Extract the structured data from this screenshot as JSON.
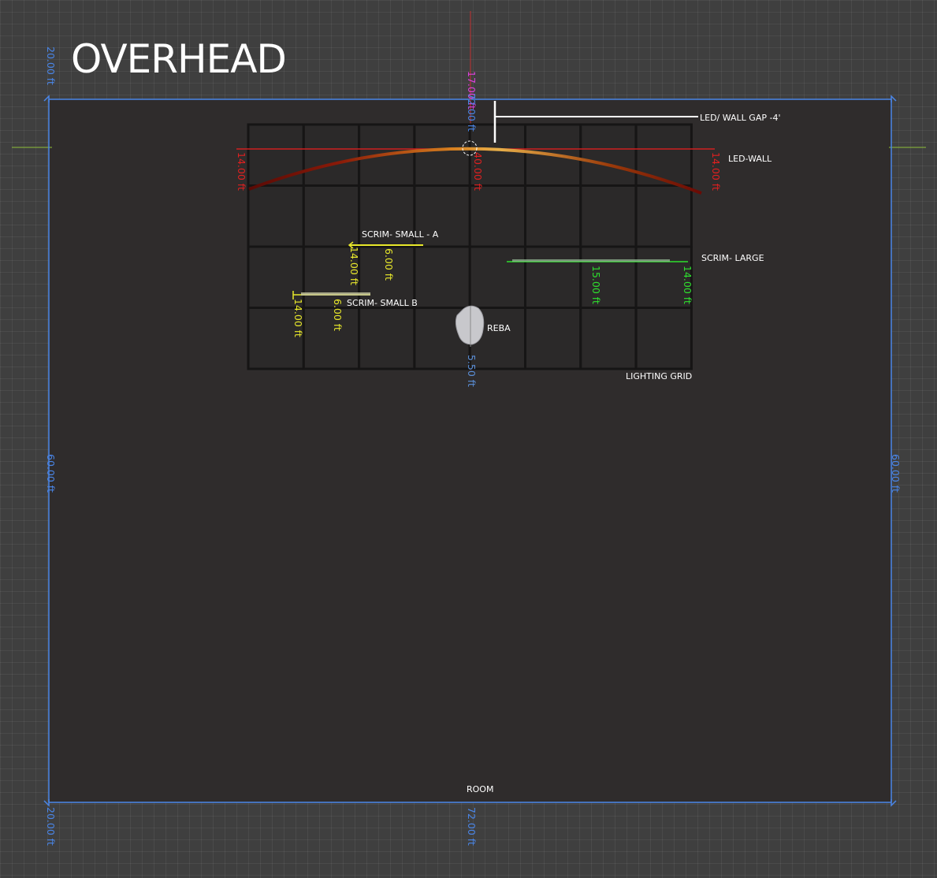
{
  "view_title": "OVERHEAD",
  "colors": {
    "room_border": "#4a86e8",
    "led_red": "#e02020",
    "scrim_small": "#e8e82a",
    "scrim_large": "#2ee02e",
    "reba_blue": "#5b8fd8",
    "top_magenta": "#e040e0",
    "room_fill": "#2f2c2c"
  },
  "labels": {
    "led_wall_gap": "LED/ WALL GAP -4'",
    "led_wall": "LED-WALL",
    "scrim_small_a": "SCRIM- SMALL - A",
    "scrim_small_b": "SCRIM- SMALL B",
    "scrim_large": "SCRIM- LARGE",
    "reba": "REBA",
    "lighting_grid": "LIGHTING GRID",
    "room": "ROOM"
  },
  "dimensions": {
    "room_top_left": "20.00 ft",
    "room_left": "60.00 ft",
    "room_right": "60.00 ft",
    "room_bottom_left": "20.00 ft",
    "room_bottom": "72.00 ft",
    "top_magenta": "17.00 ft",
    "top_blue": "72.00 ft",
    "led_left": "14.00 ft",
    "led_center": "40.00 ft",
    "led_right": "14.00 ft",
    "scrim_a_width": "14.00 ft",
    "scrim_a_height": "6.00 ft",
    "scrim_b_width": "14.00 ft",
    "scrim_b_height": "6.00 ft",
    "scrim_large_width": "15.00 ft",
    "scrim_large_height": "14.00 ft",
    "reba_height": "5.50 ft"
  }
}
